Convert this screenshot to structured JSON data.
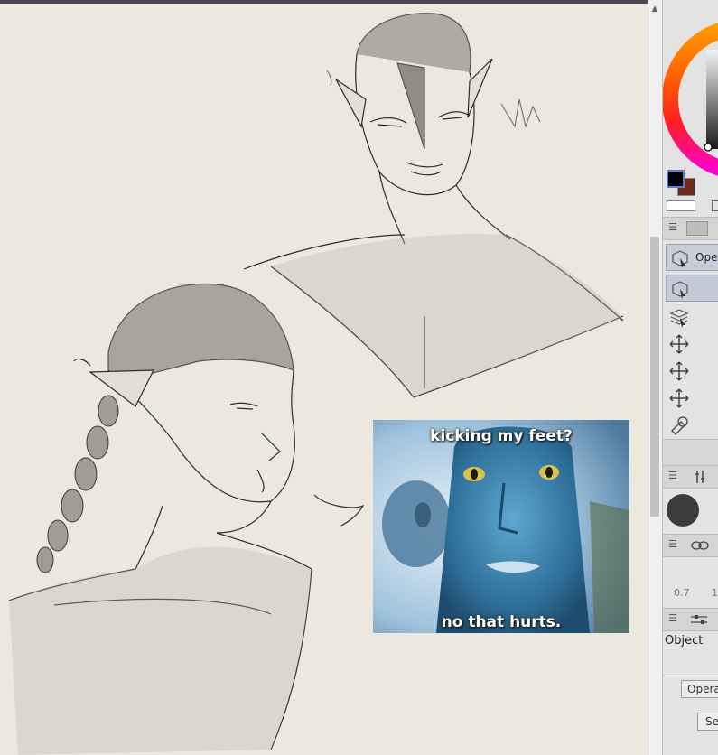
{
  "meme": {
    "top_text": "kicking my feet?",
    "bottom_text": "no that hurts."
  },
  "right_panel": {
    "operation_button_label": "Ope",
    "sub_tool_values": [
      "0.7",
      "1"
    ],
    "tool_property_title": "Object",
    "operation_dropdown_label": "Operati",
    "settings_button_label": "Se"
  },
  "colors": {
    "main_color": "#000000",
    "sub_color": "#6a2a20",
    "canvas_paper": "#ece8de",
    "sketch_tone": "#9c9a90",
    "selection_highlight": "#c9ced9"
  },
  "icons": [
    "object-select-icon",
    "layer-select-icon",
    "move-icon",
    "move-layer-icon",
    "move-all-icon",
    "light-table-icon",
    "brush-size-icon",
    "color-wheel-icon"
  ]
}
